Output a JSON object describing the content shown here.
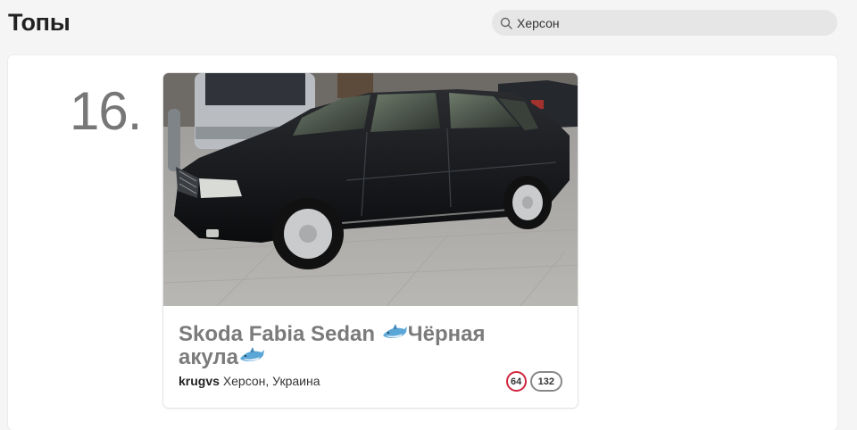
{
  "page": {
    "title": "Топы"
  },
  "search": {
    "value": "Херсон"
  },
  "entry": {
    "rank": "16.",
    "title": "Skoda Fabia Sedan",
    "title_part2": "Чёрная",
    "title_part3": "акула",
    "emoji": "shark",
    "author": "krugvs",
    "location": "Херсон, Украина",
    "likes": "64",
    "comments": "132"
  },
  "colors": {
    "accent_red": "#d0263e",
    "title_gray": "#7b7b7b",
    "rank_gray": "#777777",
    "search_bg": "#e6e6e6"
  }
}
